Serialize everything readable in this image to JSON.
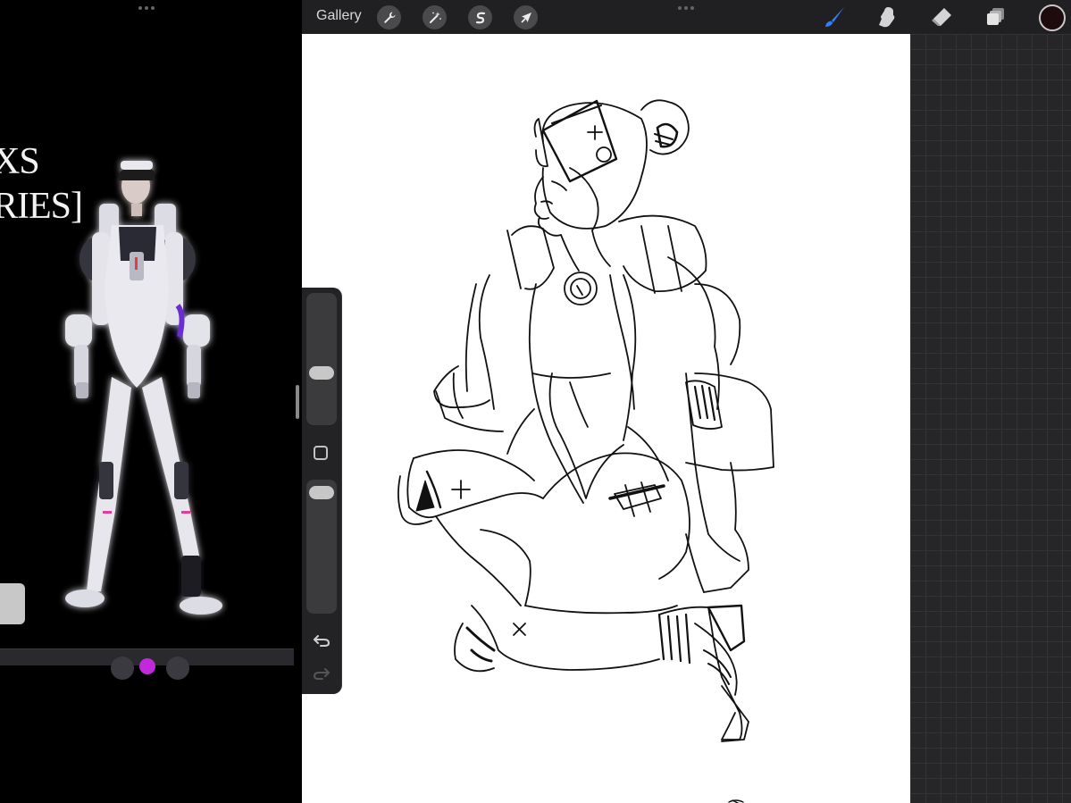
{
  "reference_app": {
    "title_lines": "XS\nRIES]"
  },
  "toolbar": {
    "gallery_label": "Gallery",
    "left_tools": [
      {
        "name": "actions",
        "icon": "wrench-icon"
      },
      {
        "name": "adjustments",
        "icon": "magic-wand-icon"
      },
      {
        "name": "selection",
        "icon": "selection-s-icon"
      },
      {
        "name": "transform",
        "icon": "arrow-cursor-icon"
      }
    ],
    "right_tools": [
      {
        "name": "brush",
        "icon": "paintbrush-icon",
        "active": true
      },
      {
        "name": "smudge",
        "icon": "smudge-icon",
        "active": false
      },
      {
        "name": "eraser",
        "icon": "eraser-icon",
        "active": false
      },
      {
        "name": "layers",
        "icon": "layers-icon",
        "active": false
      }
    ],
    "current_color": "#1d0b0e",
    "accent_color": "#2f7ff7"
  },
  "sidebar": {
    "brush_size": 0.38,
    "opacity": 0.97
  }
}
